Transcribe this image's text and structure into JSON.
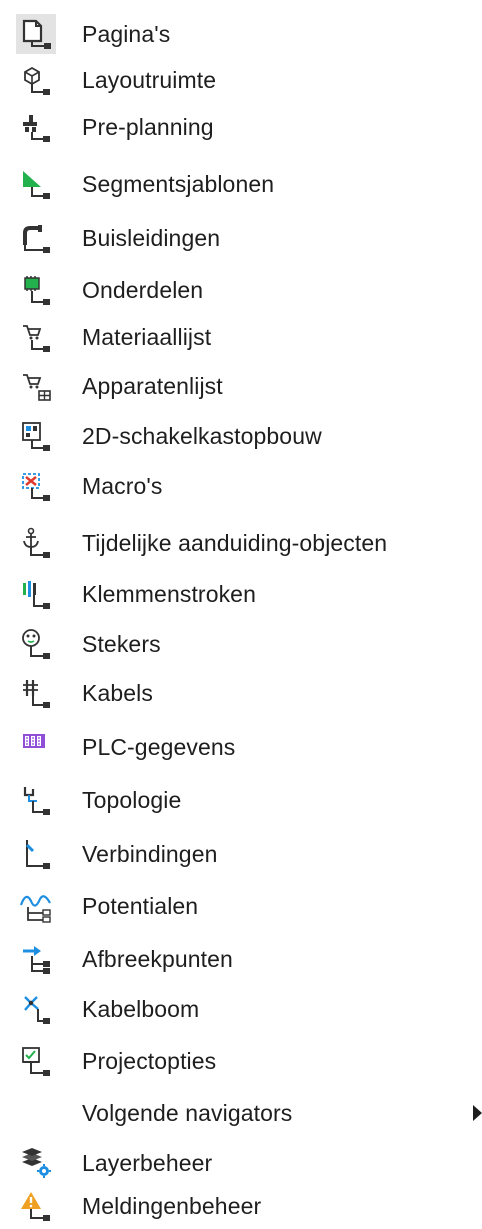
{
  "menu": {
    "items": [
      {
        "label": "Pagina's",
        "icon": "page-icon"
      },
      {
        "label": "Layoutruimte",
        "icon": "layout-space-icon"
      },
      {
        "label": "Pre-planning",
        "icon": "pre-planning-icon"
      },
      {
        "label": "Segmentsjablonen",
        "icon": "segment-template-icon"
      },
      {
        "label": "Buisleidingen",
        "icon": "pipeline-icon"
      },
      {
        "label": "Onderdelen",
        "icon": "parts-icon"
      },
      {
        "label": "Materiaallijst",
        "icon": "material-list-icon"
      },
      {
        "label": "Apparatenlijst",
        "icon": "device-list-icon"
      },
      {
        "label": "2D-schakelkastopbouw",
        "icon": "cabinet-layout-icon"
      },
      {
        "label": "Macro's",
        "icon": "macro-icon"
      },
      {
        "label": "Tijdelijke aanduiding-objecten",
        "icon": "placeholder-anchor-icon"
      },
      {
        "label": "Klemmenstroken",
        "icon": "terminal-strip-icon"
      },
      {
        "label": "Stekers",
        "icon": "plug-icon"
      },
      {
        "label": "Kabels",
        "icon": "cable-icon"
      },
      {
        "label": "PLC-gegevens",
        "icon": "plc-icon"
      },
      {
        "label": "Topologie",
        "icon": "topology-icon"
      },
      {
        "label": "Verbindingen",
        "icon": "connection-icon"
      },
      {
        "label": "Potentialen",
        "icon": "potential-wave-icon"
      },
      {
        "label": "Afbreekpunten",
        "icon": "interruption-point-icon"
      },
      {
        "label": "Kabelboom",
        "icon": "cable-tree-icon"
      },
      {
        "label": "Projectopties",
        "icon": "project-options-icon"
      },
      {
        "label": "Volgende navigators",
        "icon": "",
        "submenu": true
      },
      {
        "label": "Layerbeheer",
        "icon": "layer-management-icon"
      },
      {
        "label": "Meldingenbeheer",
        "icon": "message-management-icon"
      }
    ]
  },
  "colors": {
    "text": "#1e1e1e",
    "selected_bg": "#e3e3e3",
    "green": "#22b14c",
    "blue": "#1e8fe0",
    "purple": "#8f4fd6",
    "orange": "#f0a020",
    "red": "#e03a2f"
  }
}
